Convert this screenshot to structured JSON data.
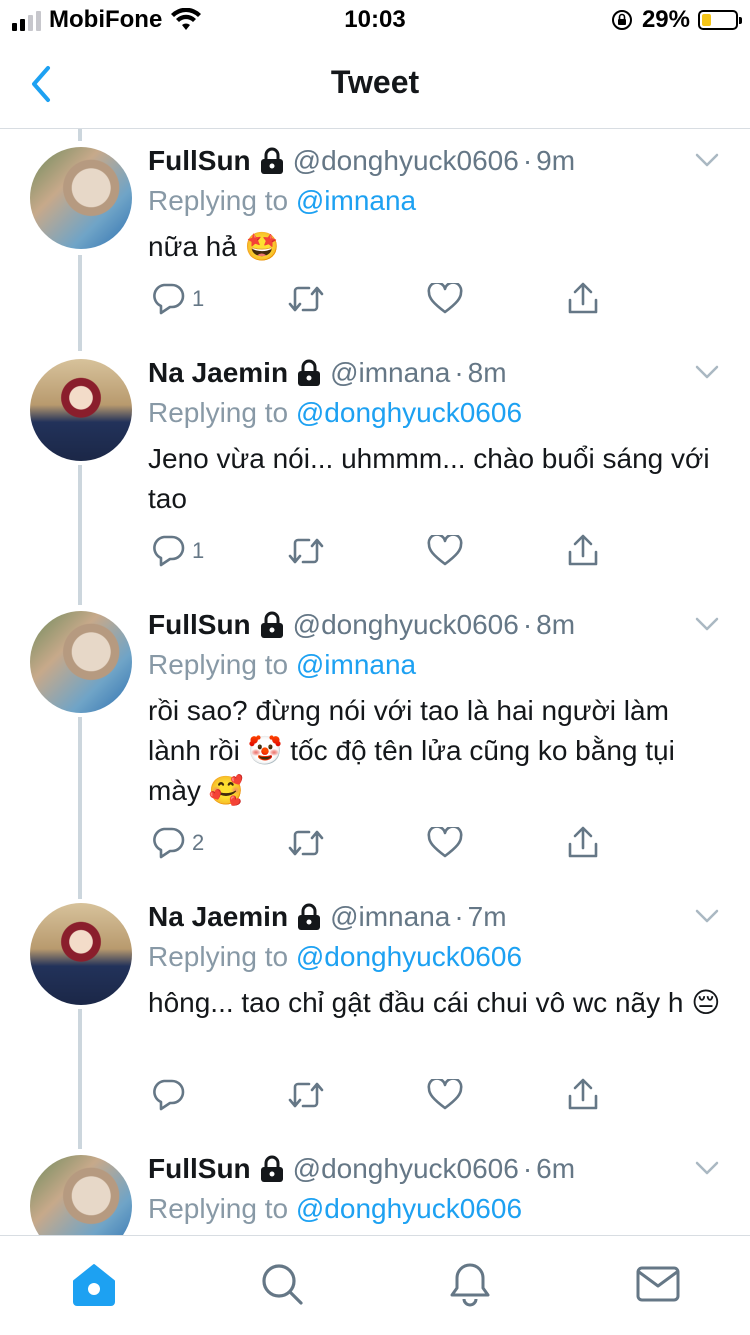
{
  "status_bar": {
    "carrier": "MobiFone",
    "time": "10:03",
    "battery_percent": "29%",
    "battery_level": 0.29,
    "battery_color": "#f5c518"
  },
  "nav": {
    "title": "Tweet",
    "back_icon": "chevron-left-icon",
    "accent_color": "#1da1f2"
  },
  "tweets": [
    {
      "name": "FullSun",
      "handle": "@donghyuck0606",
      "dot": "·",
      "time": "9m",
      "replying_label": "Replying to",
      "replying_to": "@imnana",
      "text": "nữa hả 🤩",
      "reply_count": "1",
      "locked": true
    },
    {
      "name": "Na Jaemin",
      "handle": "@imnana",
      "dot": "·",
      "time": "8m",
      "replying_label": "Replying to",
      "replying_to": "@donghyuck0606",
      "text": "Jeno vừa nói... uhmmm... chào buổi sáng với tao",
      "reply_count": "1",
      "locked": true
    },
    {
      "name": "FullSun",
      "handle": "@donghyuck0606",
      "dot": "·",
      "time": "8m",
      "replying_label": "Replying to",
      "replying_to": "@imnana",
      "text": "rồi sao? đừng nói với tao là hai người làm lành rồi 🤡 tốc độ tên lửa cũng ko bằng tụi mày 🥰",
      "reply_count": "2",
      "locked": true
    },
    {
      "name": "Na Jaemin",
      "handle": "@imnana",
      "dot": "·",
      "time": "7m",
      "replying_label": "Replying to",
      "replying_to": "@donghyuck0606",
      "text": "hông... tao chỉ gật đầu cái chui vô wc nãy h 😔",
      "reply_count": "",
      "locked": true
    },
    {
      "name": "FullSun",
      "handle": "@donghyuck0606",
      "dot": "·",
      "time": "6m",
      "replying_label": "Replying to",
      "replying_to": "@donghyuck0606",
      "text": "",
      "reply_count": "",
      "locked": true
    }
  ],
  "tabbar": {
    "items": [
      "home-icon",
      "search-icon",
      "notifications-icon",
      "messages-icon"
    ],
    "active": "home-icon"
  }
}
